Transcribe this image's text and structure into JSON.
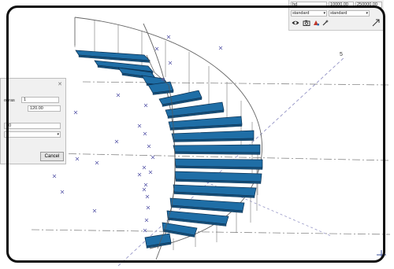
{
  "property_panel": {
    "field_top_left": "hd",
    "field_value_1": "10000.00",
    "field_value_2": "250000.00",
    "select_1": "standard",
    "select_2": "standard",
    "tools": [
      "eye-icon",
      "camera-icon",
      "paint-icon",
      "wand-icon"
    ]
  },
  "dialog": {
    "label_prefix": "opras",
    "field_1": "1",
    "field_2": "120.00",
    "field_3": "00",
    "select_value": "",
    "cancel_label": "Cancel"
  },
  "viewport": {
    "axis_label": "5"
  },
  "colors": {
    "step_fill": "#1f6ea6",
    "step_edge": "#0a2f50",
    "guide_line": "#6a6aa8",
    "marker": "#5a5aaa"
  }
}
